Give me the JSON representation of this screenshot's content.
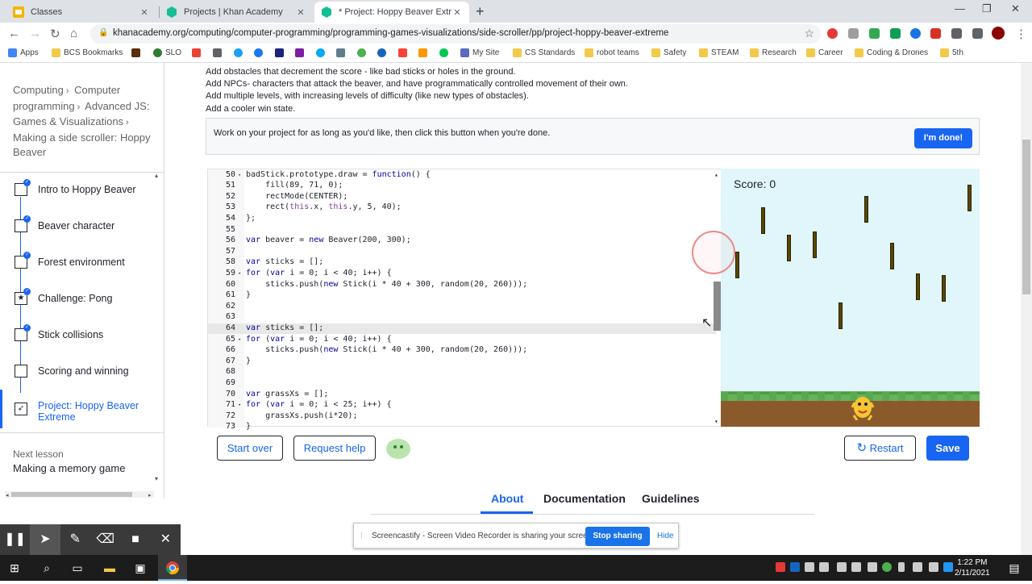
{
  "tabs": [
    {
      "title": "Classes",
      "active": false
    },
    {
      "title": "Projects | Khan Academy",
      "active": false
    },
    {
      "title": "* Project: Hoppy Beaver Extreme",
      "active": true
    }
  ],
  "url": "khanacademy.org/computing/computer-programming/programming-games-visualizations/side-scroller/pp/project-hoppy-beaver-extreme",
  "bookmarks": [
    "Apps",
    "BCS Bookmarks",
    "SLO",
    "My Site",
    "CS Standards",
    "robot teams",
    "Safety",
    "STEAM",
    "Research",
    "Career",
    "Coding & Drones",
    "5th"
  ],
  "breadcrumb": {
    "l1": "Computing",
    "l2": "Computer programming",
    "l3": "Advanced JS: Games & Visualizations",
    "l4": "Making a side scroller: Hoppy Beaver"
  },
  "lessons": [
    {
      "label": "Intro to Hoppy Beaver",
      "done": true,
      "icon": "doc"
    },
    {
      "label": "Beaver character",
      "done": true,
      "icon": "doc"
    },
    {
      "label": "Forest environment",
      "done": true,
      "icon": "doc"
    },
    {
      "label": "Challenge: Pong",
      "done": true,
      "icon": "star"
    },
    {
      "label": "Stick collisions",
      "done": true,
      "icon": "doc"
    },
    {
      "label": "Scoring and winning",
      "done": false,
      "icon": "doc"
    },
    {
      "label": "Project: Hoppy Beaver Extreme",
      "done": false,
      "icon": "rocket"
    }
  ],
  "next_lesson": {
    "label": "Next lesson",
    "title": "Making a memory game"
  },
  "description": [
    "Add obstacles that decrement the score - like bad sticks or holes in the ground.",
    "Add NPCs- characters that attack the beaver, and have programmatically controlled movement of their own.",
    "Add multiple levels, with increasing levels of difficulty (like new types of obstacles).",
    "Add a cooler win state."
  ],
  "done_box": {
    "text": "Work on your project for as long as you'd like, then click this button when you're done.",
    "button": "I'm done!"
  },
  "code_lines": [
    {
      "n": "50",
      "fold": true,
      "text": "badStick.prototype.draw = function() {"
    },
    {
      "n": "51",
      "fold": false,
      "text": "    fill(89, 71, 0);"
    },
    {
      "n": "52",
      "fold": false,
      "text": "    rectMode(CENTER);"
    },
    {
      "n": "53",
      "fold": false,
      "text": "    rect(this.x, this.y, 5, 40);"
    },
    {
      "n": "54",
      "fold": false,
      "text": "};"
    },
    {
      "n": "55",
      "fold": false,
      "text": ""
    },
    {
      "n": "56",
      "fold": false,
      "text": "var beaver = new Beaver(200, 300);"
    },
    {
      "n": "57",
      "fold": false,
      "text": ""
    },
    {
      "n": "58",
      "fold": false,
      "text": "var sticks = [];"
    },
    {
      "n": "59",
      "fold": true,
      "text": "for (var i = 0; i < 40; i++) {"
    },
    {
      "n": "60",
      "fold": false,
      "text": "    sticks.push(new Stick(i * 40 + 300, random(20, 260)));"
    },
    {
      "n": "61",
      "fold": false,
      "text": "}"
    },
    {
      "n": "62",
      "fold": false,
      "text": ""
    },
    {
      "n": "63",
      "fold": false,
      "text": ""
    },
    {
      "n": "64",
      "fold": false,
      "text": "var sticks = [];",
      "current": true
    },
    {
      "n": "65",
      "fold": true,
      "text": "for (var i = 0; i < 40; i++) {"
    },
    {
      "n": "66",
      "fold": false,
      "text": "    sticks.push(new Stick(i * 40 + 300, random(20, 260)));"
    },
    {
      "n": "67",
      "fold": false,
      "text": "}"
    },
    {
      "n": "68",
      "fold": false,
      "text": ""
    },
    {
      "n": "69",
      "fold": false,
      "text": ""
    },
    {
      "n": "70",
      "fold": false,
      "text": "var grassXs = [];"
    },
    {
      "n": "71",
      "fold": true,
      "text": "for (var i = 0; i < 25; i++) {"
    },
    {
      "n": "72",
      "fold": false,
      "text": "    grassXs.push(i*20);"
    },
    {
      "n": "73",
      "fold": false,
      "text": "}"
    }
  ],
  "canvas": {
    "score": "Score: 0",
    "sky": "#e0f6fa",
    "grass": "#67b35c",
    "dirt": "#8b5a2b",
    "stick_color": "#594700"
  },
  "buttons": {
    "start_over": "Start over",
    "request_help": "Request help",
    "restart": "Restart",
    "save": "Save"
  },
  "page_tabs": [
    "About",
    "Documentation",
    "Guidelines"
  ],
  "screencastify": {
    "message": "Screencastify - Screen Video Recorder is sharing your screen.",
    "stop": "Stop sharing",
    "hide": "Hide"
  },
  "clock": {
    "time": "1:22 PM",
    "date": "2/11/2021"
  },
  "colors": {
    "accent": "#1865f2",
    "chrome_bg": "#dee1e6"
  }
}
